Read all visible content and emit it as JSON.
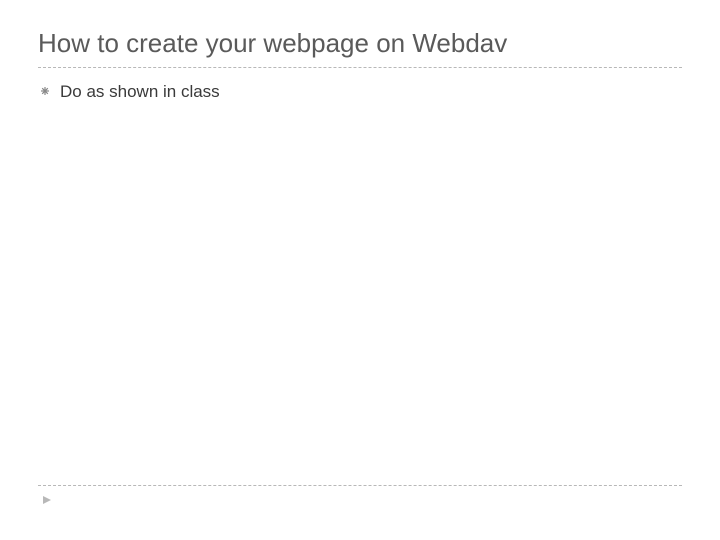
{
  "slide": {
    "title": "How to create your webpage on Webdav",
    "bullets": [
      {
        "text": "Do as shown in class"
      }
    ]
  }
}
